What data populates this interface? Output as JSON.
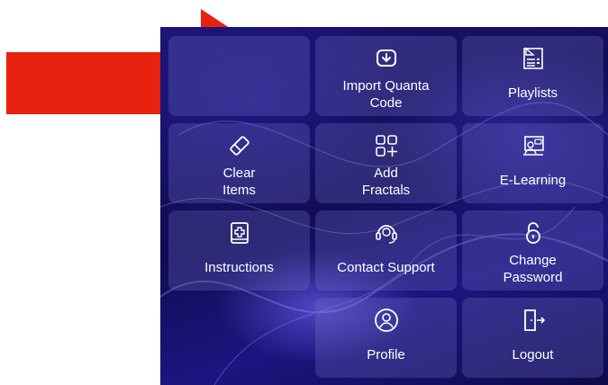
{
  "tiles": [
    {
      "id": "import-quanta-code",
      "label": "Import Quanta\nCode",
      "icon": "download-badge-icon"
    },
    {
      "id": "playlists",
      "label": "Playlists",
      "icon": "playlist-icon"
    },
    {
      "id": "clear-items",
      "label": "Clear\nItems",
      "icon": "eraser-icon"
    },
    {
      "id": "add-fractals",
      "label": "Add\nFractals",
      "icon": "grid-add-icon"
    },
    {
      "id": "e-learning",
      "label": "E-Learning",
      "icon": "elearning-icon"
    },
    {
      "id": "instructions",
      "label": "Instructions",
      "icon": "medical-book-icon"
    },
    {
      "id": "contact-support",
      "label": "Contact Support",
      "icon": "support-headset-icon"
    },
    {
      "id": "change-password",
      "label": "Change\nPassword",
      "icon": "padlock-icon"
    },
    {
      "id": "profile",
      "label": "Profile",
      "icon": "user-icon"
    },
    {
      "id": "logout",
      "label": "Logout",
      "icon": "door-exit-icon"
    }
  ],
  "colors": {
    "arrow": "#e8220f",
    "background": "#15106a",
    "tile": "rgba(120,120,200,0.28)"
  }
}
